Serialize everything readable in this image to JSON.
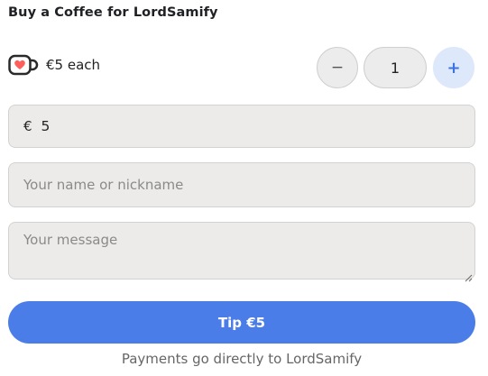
{
  "header": {
    "title": "Buy a Coffee for LordSamify"
  },
  "price": {
    "icon": "coffee-cup-heart-icon",
    "label": "€5 each"
  },
  "quantity": {
    "decrement_label": "−",
    "value": "1",
    "increment_label": "+"
  },
  "amount": {
    "currency_symbol": "€",
    "value": "5"
  },
  "name_input": {
    "placeholder": "Your name or nickname"
  },
  "message_input": {
    "placeholder": "Your message"
  },
  "tip_button": {
    "label": "Tip €5"
  },
  "footer": {
    "note": "Payments go directly to LordSamify"
  },
  "colors": {
    "accent": "#4a7de8",
    "plus_button_bg": "#dde8fb",
    "field_bg": "#ecebe9",
    "cup_red": "#ff5e5b"
  }
}
